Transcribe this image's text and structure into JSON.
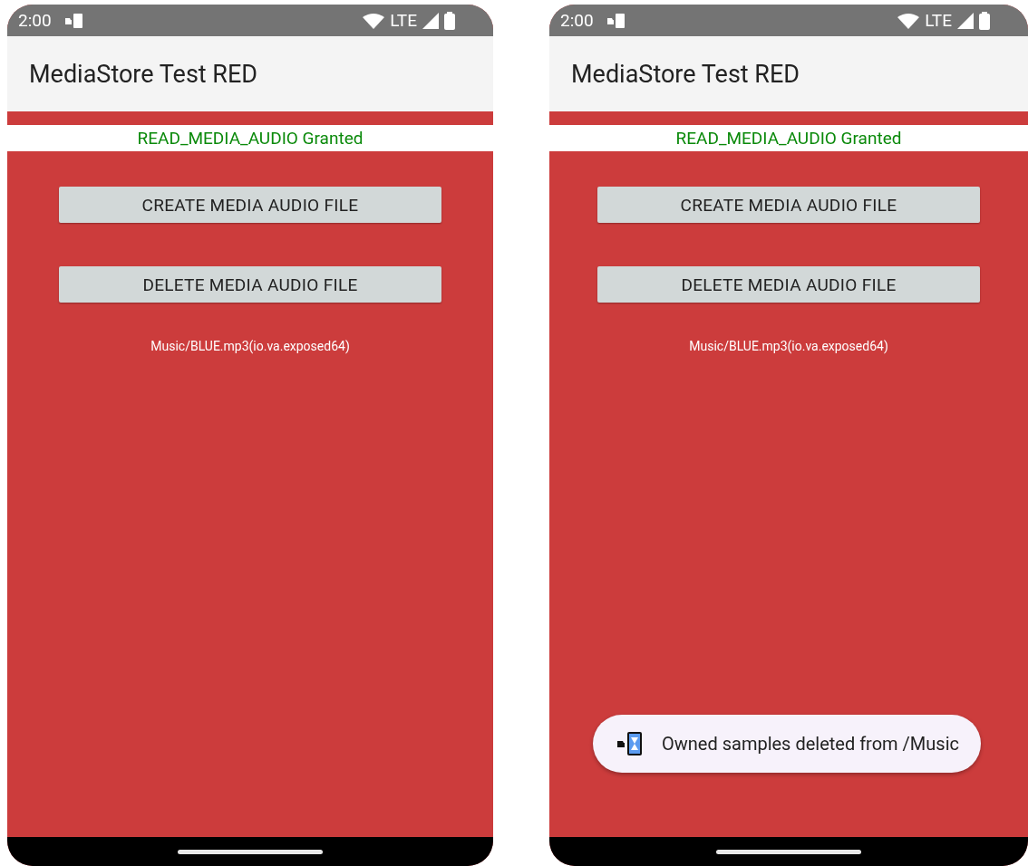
{
  "phones": [
    {
      "status_bar": {
        "time": "2:00",
        "network": "LTE"
      },
      "app_bar": {
        "title": "MediaStore Test RED"
      },
      "permission": "READ_MEDIA_AUDIO Granted",
      "buttons": [
        "CREATE MEDIA AUDIO FILE",
        "DELETE MEDIA AUDIO FILE"
      ],
      "file_path": "Music/BLUE.mp3(io.va.exposed64)"
    },
    {
      "status_bar": {
        "time": "2:00",
        "network": "LTE"
      },
      "app_bar": {
        "title": "MediaStore Test RED"
      },
      "permission": "READ_MEDIA_AUDIO Granted",
      "buttons": [
        "CREATE MEDIA AUDIO FILE",
        "DELETE MEDIA AUDIO FILE"
      ],
      "file_path": "Music/BLUE.mp3(io.va.exposed64)",
      "toast": {
        "message": "Owned samples deleted from /Music"
      }
    }
  ]
}
